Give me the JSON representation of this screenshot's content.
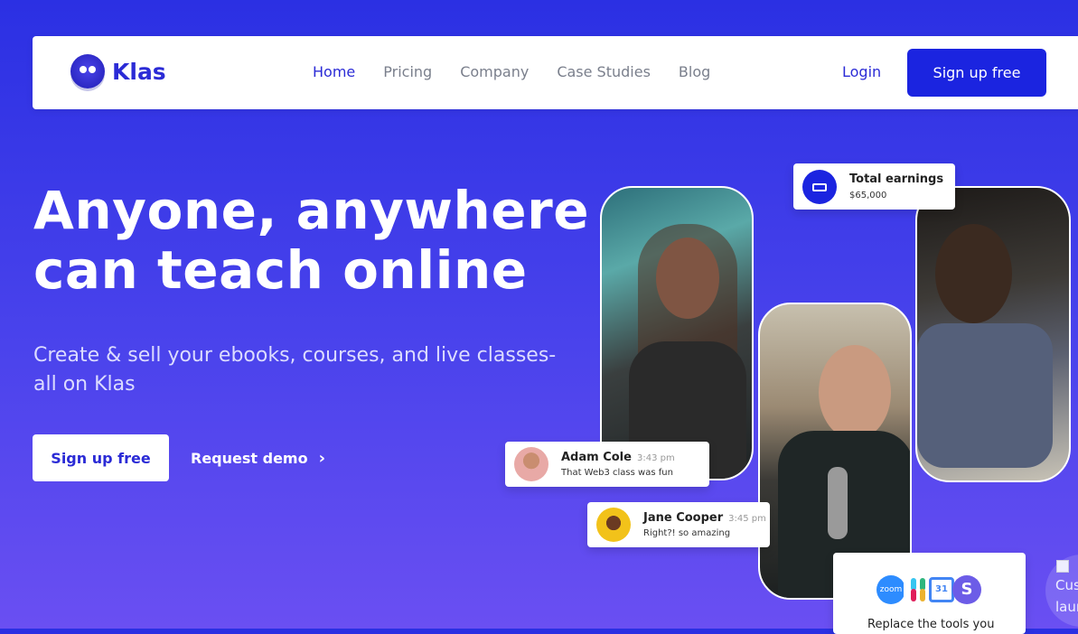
{
  "brand": {
    "name": "Klas"
  },
  "nav": {
    "links": [
      "Home",
      "Pricing",
      "Company",
      "Case Studies",
      "Blog"
    ],
    "active": "Home",
    "login": "Login",
    "signup": "Sign up free"
  },
  "hero": {
    "title_line1": "Anyone, anywhere",
    "title_line2": "can teach online",
    "subtitle_line1": "Create & sell your ebooks, courses, and live classes-",
    "subtitle_line2": "all on Klas",
    "cta_primary": "Sign up free",
    "cta_secondary": "Request demo"
  },
  "earnings": {
    "title": "Total earnings",
    "value": "$65,000"
  },
  "messages": [
    {
      "name": "Adam Cole",
      "time": "3:43 pm",
      "text": "That Web3 class was fun"
    },
    {
      "name": "Jane Cooper",
      "time": "3:45 pm",
      "text": "Right?! so amazing"
    }
  ],
  "tools": {
    "zoom_label": "zoom",
    "calendar_day": "31",
    "stripe_letter": "S",
    "caption": "Replace the tools you"
  },
  "launcher": {
    "text": "Cus laun"
  },
  "colors": {
    "primary": "#1b24e0",
    "brand_text": "#2b2bd6",
    "background_top": "#2b30e3",
    "background_bottom": "#6a4ff2"
  }
}
